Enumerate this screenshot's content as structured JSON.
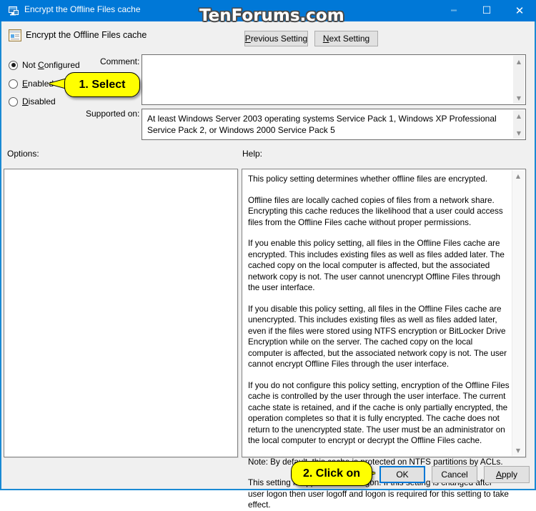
{
  "window": {
    "title": "Encrypt the Offline Files cache",
    "title_icon": "policy-computer-icon",
    "caption_buttons": {
      "minimize": "minimize-icon",
      "maximize": "maximize-icon",
      "close": "close-icon"
    },
    "accent_color": "#0078d7",
    "border_color": "#1a8ad4"
  },
  "watermark": {
    "text": "TenForums.com"
  },
  "header": {
    "icon": "group-policy-setting-icon",
    "title": "Encrypt the Offline Files cache",
    "previous_setting_label": "Previous Setting",
    "previous_setting_mnemonic": "P",
    "next_setting_label": "Next Setting",
    "next_setting_mnemonic": "N"
  },
  "state_options": {
    "selected": "Not Configured",
    "items": [
      {
        "label": "Not Configured",
        "mnemonic": "C",
        "pre": "Not ",
        "post": "onfigured",
        "checked": true
      },
      {
        "label": "Enabled",
        "mnemonic": "E",
        "pre": "",
        "post": "nabled",
        "checked": false
      },
      {
        "label": "Disabled",
        "mnemonic": "D",
        "pre": "",
        "post": "isabled",
        "checked": false
      }
    ]
  },
  "fields": {
    "comment_label": "Comment:",
    "comment_value": "",
    "supported_label": "Supported on:",
    "supported_value": "At least Windows Server 2003 operating systems Service Pack 1, Windows XP Professional Service Pack 2, or Windows 2000 Service Pack 5"
  },
  "panes": {
    "options_label": "Options:",
    "options_content": "",
    "help_label": "Help:",
    "help_paragraphs": [
      "This policy setting determines whether offline files are encrypted.",
      "Offline files are locally cached copies of files from a network share. Encrypting this cache reduces the likelihood that a user could access files from the Offline Files cache without proper permissions.",
      "If you enable this policy setting, all files in the Offline Files cache are encrypted. This includes existing files as well as files added later. The cached copy on the local computer is affected, but the associated network copy is not. The user cannot unencrypt Offline Files through the user interface.",
      "If you disable this policy setting, all files in the Offline Files cache are unencrypted. This includes existing files as well as files added later, even if the files were stored using NTFS encryption or BitLocker Drive Encryption while on the server. The cached copy on the local computer is affected, but the associated network copy is not. The user cannot encrypt Offline Files through the user interface.",
      "If you do not configure this policy setting, encryption of the Offline Files cache is controlled by the user through the user interface. The current cache state is retained, and if the cache is only partially encrypted, the operation completes so that it is fully encrypted. The cache does not return to the unencrypted state. The user must be an administrator on the local computer to encrypt or decrypt the Offline Files cache.",
      "Note: By default, this cache is protected on NTFS partitions by ACLs.",
      "This setting is applied at user logon. If this setting is changed after user logon then user logoff and logon is required for this setting to take effect."
    ]
  },
  "footer": {
    "ok_label": "OK",
    "cancel_label": "Cancel",
    "apply_label": "Apply",
    "apply_mnemonic": "A",
    "focused_button": "OK"
  },
  "callouts": [
    {
      "id": "select",
      "text": "1. Select",
      "color": "#ffff00",
      "points_at": "Enabled radio button"
    },
    {
      "id": "click",
      "text": "2. Click on",
      "color": "#ffff00",
      "points_at": "OK button"
    }
  ]
}
